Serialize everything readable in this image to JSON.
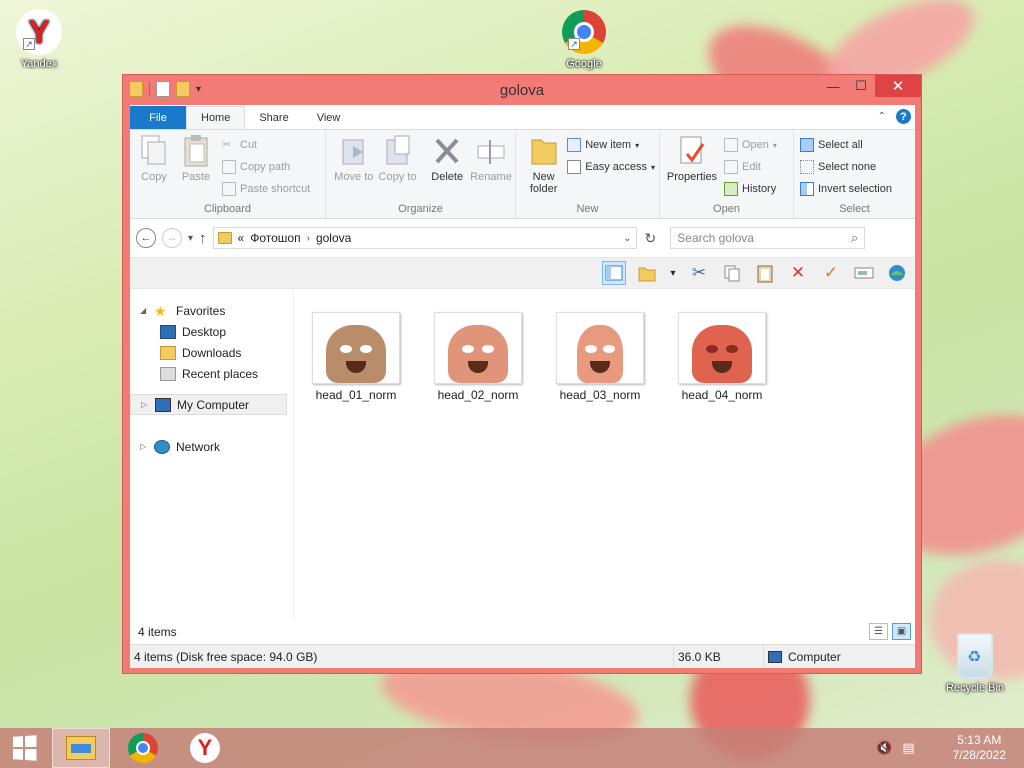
{
  "desktop": {
    "icons": [
      {
        "label": "Yandex"
      },
      {
        "label": "Google"
      },
      {
        "label": "Recycle Bin"
      }
    ]
  },
  "window": {
    "title": "golova",
    "tabs": [
      "File",
      "Home",
      "Share",
      "View"
    ],
    "ribbon": {
      "clipboard": {
        "label": "Clipboard",
        "copy": "Copy",
        "paste": "Paste",
        "cut": "Cut",
        "copy_path": "Copy path",
        "paste_shortcut": "Paste shortcut"
      },
      "organize": {
        "label": "Organize",
        "move_to": "Move to",
        "copy_to": "Copy to",
        "delete": "Delete",
        "rename": "Rename"
      },
      "new": {
        "label": "New",
        "new_folder": "New folder",
        "new_item": "New item",
        "easy_access": "Easy access"
      },
      "open": {
        "label": "Open",
        "properties": "Properties",
        "open": "Open",
        "edit": "Edit",
        "history": "History"
      },
      "select": {
        "label": "Select",
        "select_all": "Select all",
        "select_none": "Select none",
        "invert_selection": "Invert selection"
      }
    },
    "address": {
      "prefix": "«",
      "segments": [
        "Фотошоп",
        "golova"
      ],
      "search_placeholder": "Search golova"
    },
    "nav_pane": {
      "favorites": "Favorites",
      "desktop": "Desktop",
      "downloads": "Downloads",
      "recent_places": "Recent places",
      "my_computer": "My Computer",
      "network": "Network"
    },
    "files": [
      {
        "name": "head_01_norm",
        "color": "#b98c6a"
      },
      {
        "name": "head_02_norm",
        "color": "#e0957a"
      },
      {
        "name": "head_03_norm",
        "color": "#e89a7e"
      },
      {
        "name": "head_04_norm",
        "color": "#e0634f"
      }
    ],
    "status": {
      "item_count": "4 items",
      "bar_info": "4 items (Disk free space: 94.0 GB)",
      "size": "36.0 KB",
      "location": "Computer"
    }
  },
  "taskbar": {
    "time": "5:13 AM",
    "date": "7/28/2022"
  },
  "colors": {
    "window_frame": "#f27b76",
    "file_tab": "#1979ca",
    "close_button": "#e04343"
  }
}
